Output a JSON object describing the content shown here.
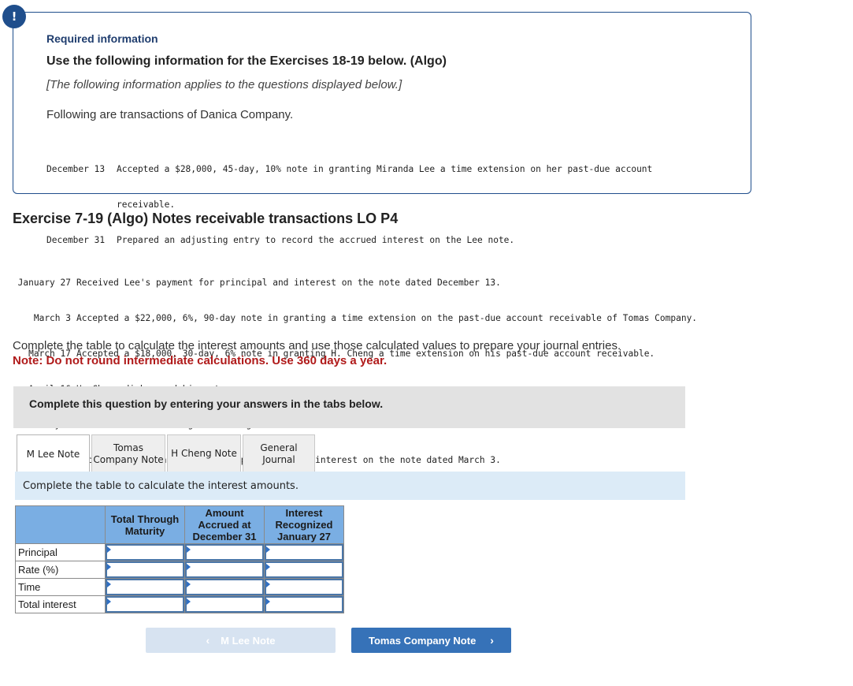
{
  "required_info": {
    "badge": "!",
    "title": "Required information",
    "heading": "Use the following information for the Exercises 18-19 below. (Algo)",
    "applies": "[The following information applies to the questions displayed below.]",
    "intro": "Following are transactions of Danica Company.",
    "transactions": [
      {
        "date": "December 13",
        "text": "Accepted a $28,000, 45-day, 10% note in granting Miranda Lee a time extension on her past-due account",
        "continuation": "receivable."
      },
      {
        "date": "December 31",
        "text": "Prepared an adjusting entry to record the accrued interest on the Lee note."
      }
    ]
  },
  "exercise": {
    "title": "Exercise 7-19 (Algo) Notes receivable transactions LO P4",
    "transactions": [
      {
        "date": "January 27",
        "text": "Received Lee's payment for principal and interest on the note dated December 13."
      },
      {
        "date": "March 3",
        "text": "Accepted a $22,000, 6%, 90-day note in granting a time extension on the past-due account receivable of Tomas Company."
      },
      {
        "date": "March 17",
        "text": "Accepted a $18,000, 30-day, 6% note in granting H. Cheng a time extension on his past-due account receivable."
      },
      {
        "date": "April 16",
        "text": "H. Cheng dishonored his note."
      },
      {
        "date": "May 1",
        "text": "Wrote off the H. Cheng account against the Allowance for Doubtful Accounts."
      },
      {
        "date": "June 1",
        "text": "Received the Tomas payment for principal and interest on the note dated March 3."
      }
    ],
    "instruction": "Complete the table to calculate the interest amounts and use those calculated values to prepare your journal entries.",
    "note": "Note: Do not round intermediate calculations. Use 360 days a year."
  },
  "question_bar": "Complete this question by entering your answers in the tabs below.",
  "tabs": [
    {
      "label": "M Lee Note",
      "active": true
    },
    {
      "label": "Tomas Company Note",
      "active": false
    },
    {
      "label": "H Cheng Note",
      "active": false
    },
    {
      "label": "General Journal",
      "active": false
    }
  ],
  "panel": {
    "header": "Complete the table to calculate the interest amounts.",
    "table": {
      "columns": [
        "",
        "Total Through Maturity",
        "Amount Accrued at December 31",
        "Interest Recognized January 27"
      ],
      "rows": [
        {
          "label": "Principal",
          "values": [
            "",
            "",
            ""
          ]
        },
        {
          "label": "Rate (%)",
          "values": [
            "",
            "",
            ""
          ]
        },
        {
          "label": "Time",
          "values": [
            "",
            "",
            ""
          ]
        },
        {
          "label": "Total interest",
          "values": [
            "",
            "",
            ""
          ]
        }
      ]
    }
  },
  "nav": {
    "prev_label": "M Lee Note",
    "prev_icon": "chevron-left-icon",
    "next_label": "Tomas Company Note",
    "next_icon": "chevron-right-icon"
  },
  "colors": {
    "brand_blue": "#1f4e8c",
    "note_red": "#b01a1a",
    "table_header": "#7aaee3",
    "next_button": "#3672b8",
    "prev_button_disabled": "#d7e3f1"
  }
}
